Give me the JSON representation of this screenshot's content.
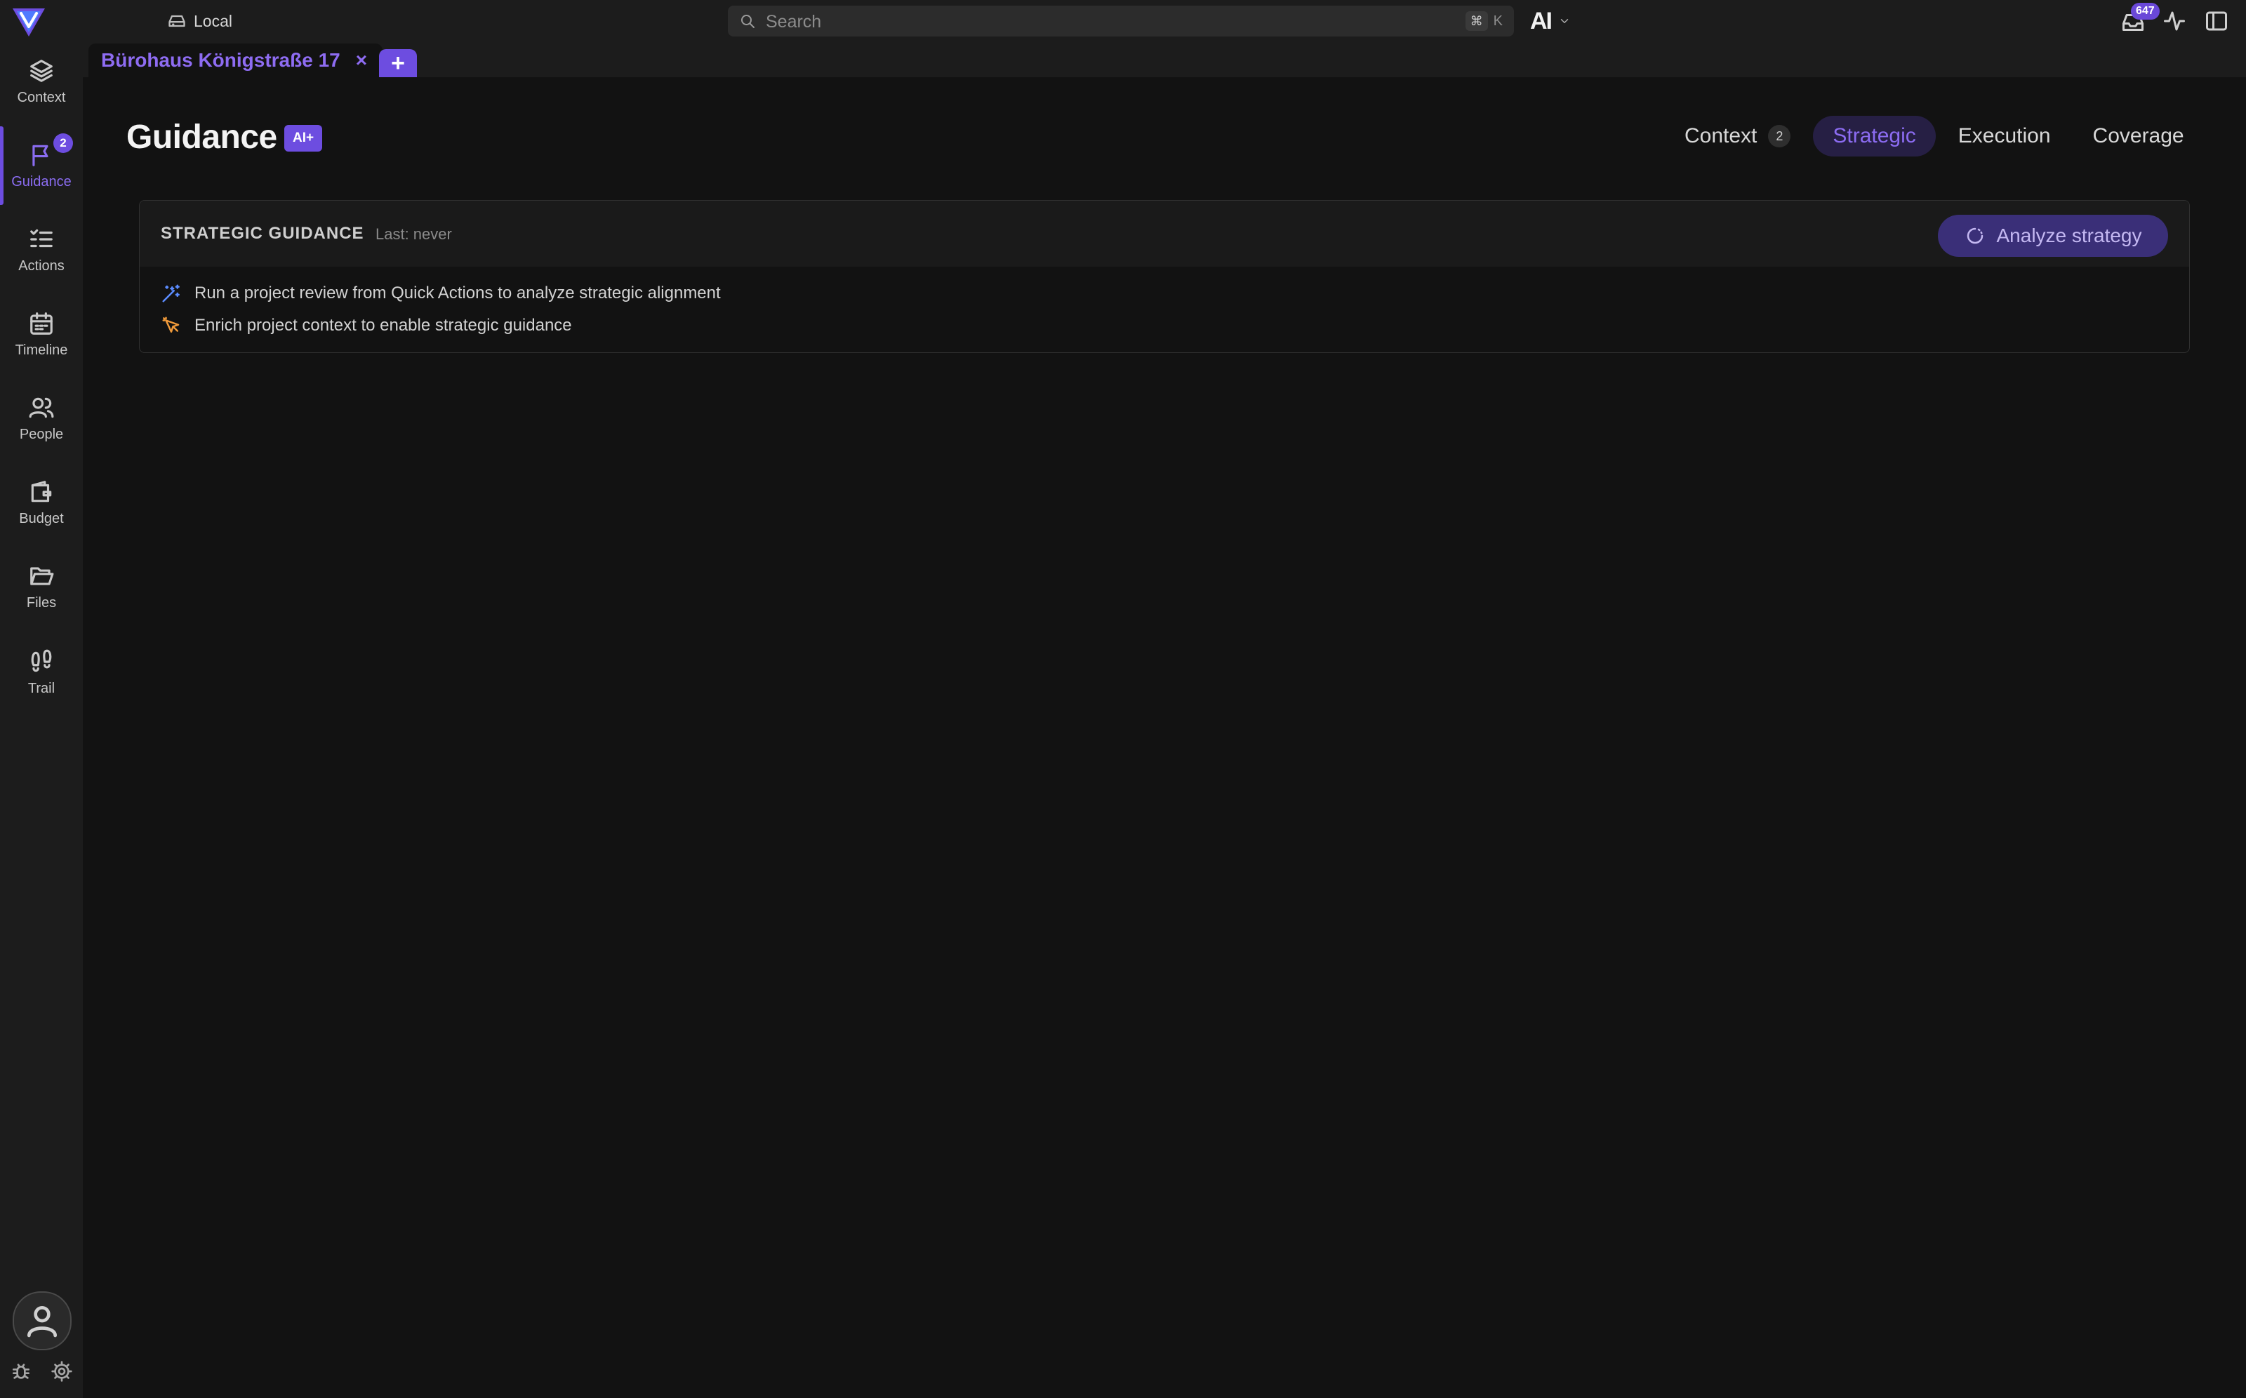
{
  "colors": {
    "accent": "#6d4de0",
    "accent_text": "#8c6cf2",
    "background": "#121212",
    "sidebar": "#1c1c1c",
    "wand_icon": "#5b8cff",
    "cursor_icon": "#f09a3a"
  },
  "topbar": {
    "environment_label": "Local",
    "search_placeholder": "Search",
    "shortcut_modifier": "⌘",
    "shortcut_key": "K",
    "brand_mark": "AI",
    "inbox_badge": "647"
  },
  "sidebar": {
    "items": [
      {
        "label": "Context",
        "icon": "layers-icon"
      },
      {
        "label": "Guidance",
        "icon": "flag-icon",
        "badge": "2",
        "active": true
      },
      {
        "label": "Actions",
        "icon": "checklist-icon"
      },
      {
        "label": "Timeline",
        "icon": "calendar-icon"
      },
      {
        "label": "People",
        "icon": "users-icon"
      },
      {
        "label": "Budget",
        "icon": "wallet-icon"
      },
      {
        "label": "Files",
        "icon": "folder-icon"
      },
      {
        "label": "Trail",
        "icon": "footprints-icon"
      }
    ]
  },
  "tabs": {
    "main_tab_label": "Bürohaus Königstraße 17",
    "close_glyph": "×",
    "add_glyph": "+"
  },
  "main": {
    "title": "Guidance",
    "ai_badge": "AI+",
    "views": [
      {
        "label": "Context",
        "count": "2"
      },
      {
        "label": "Strategic",
        "active": true
      },
      {
        "label": "Execution"
      },
      {
        "label": "Coverage"
      }
    ],
    "card": {
      "title": "STRATEGIC GUIDANCE",
      "last_run": "Last: never",
      "analyze_button": "Analyze strategy",
      "tips": [
        {
          "icon": "magic-wand-icon",
          "text": "Run a project review from Quick Actions to analyze strategic alignment"
        },
        {
          "icon": "cursor-pointer-icon",
          "text": "Enrich project context to enable strategic guidance"
        }
      ]
    }
  }
}
